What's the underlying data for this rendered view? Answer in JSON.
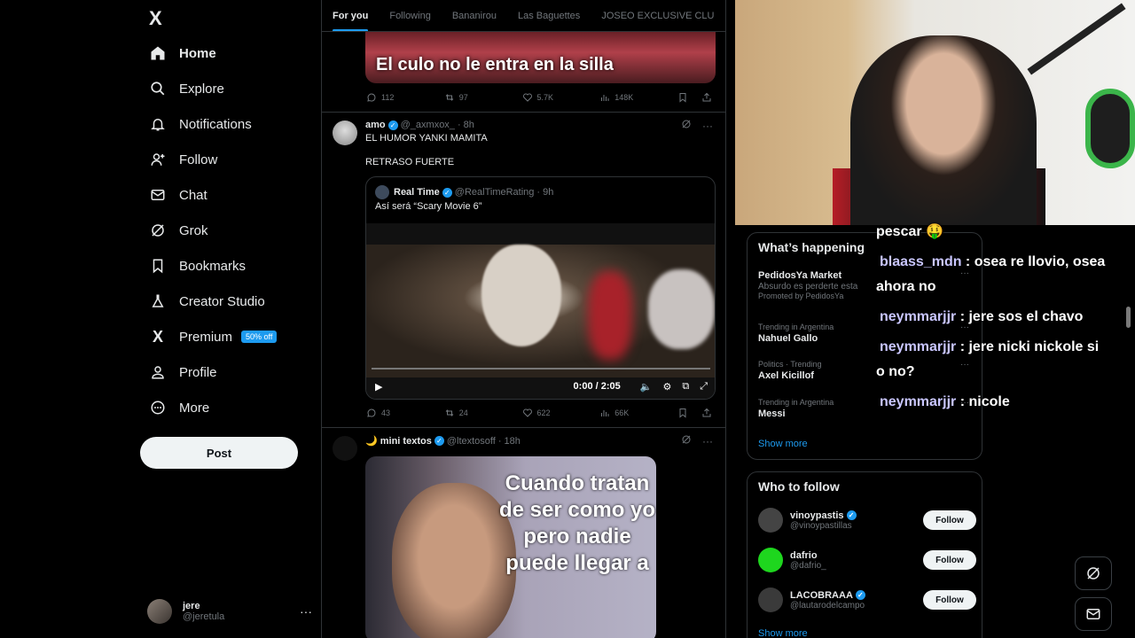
{
  "sidebar": {
    "logo": "X",
    "items": [
      {
        "label": "Home",
        "icon": "home-icon"
      },
      {
        "label": "Explore",
        "icon": "search-icon"
      },
      {
        "label": "Notifications",
        "icon": "bell-icon"
      },
      {
        "label": "Follow",
        "icon": "add-person-icon"
      },
      {
        "label": "Chat",
        "icon": "envelope-icon"
      },
      {
        "label": "Grok",
        "icon": "grok-icon"
      },
      {
        "label": "Bookmarks",
        "icon": "bookmark-icon"
      },
      {
        "label": "Creator Studio",
        "icon": "flask-icon"
      },
      {
        "label": "Premium",
        "icon": "x-logo-icon",
        "badge": "50% off"
      },
      {
        "label": "Profile",
        "icon": "person-icon"
      },
      {
        "label": "More",
        "icon": "more-circle-icon"
      }
    ],
    "post_label": "Post",
    "account": {
      "name": "jere",
      "handle": "@jeretula"
    }
  },
  "feed": {
    "tabs": [
      "For you",
      "Following",
      "Bananirou",
      "Las Baguettes",
      "JOSEO EXCLUSIVE CLU"
    ],
    "tweet1": {
      "caption": "El culo no le entra en la silla",
      "replies": "112",
      "reposts": "97",
      "likes": "5.7K",
      "views": "148K"
    },
    "tweet2": {
      "name": "amo",
      "handle": "@_axmxox_",
      "time": "8h",
      "text1": "EL HUMOR YANKI MAMITA",
      "text2": "RETRASO FUERTE",
      "quote": {
        "name": "Real Time",
        "handle": "@RealTimeRating",
        "time": "9h",
        "text": "Así será “Scary Movie 6”",
        "video_time": "0:00 / 2:05"
      },
      "replies": "43",
      "reposts": "24",
      "likes": "622",
      "views": "66K"
    },
    "tweet3": {
      "name": "🌙 mini textos",
      "handle": "@ltextosoff",
      "time": "18h",
      "meme": "Cuando tratan de ser como yo pero nadie puede llegar a"
    }
  },
  "trends": {
    "title": "What’s happening",
    "promo": {
      "title": "PedidosYa Market",
      "desc": "Absurdo es perderte esta",
      "meta": "Promoted by PedidosYa"
    },
    "items": [
      {
        "meta": "Trending in Argentina",
        "title": "Nahuel Gallo"
      },
      {
        "meta": "Politics · Trending",
        "title": "Axel Kicillof"
      },
      {
        "meta": "Trending in Argentina",
        "title": "Messi"
      }
    ],
    "show_more": "Show more"
  },
  "who_to_follow": {
    "title": "Who to follow",
    "users": [
      {
        "name": "vinoypastis",
        "handle": "@vinoypastillas",
        "verified": true
      },
      {
        "name": "dafrio",
        "handle": "@dafrio_",
        "verified": false
      },
      {
        "name": "LACOBRAAA",
        "handle": "@lautarodelcampo",
        "verified": true
      }
    ],
    "follow_label": "Follow",
    "show_more": "Show more"
  },
  "chat_overlay": [
    {
      "user": "",
      "text": "pescar 🤑"
    },
    {
      "user": "blaass_mdn",
      "text": " : osea re llovio, osea"
    },
    {
      "user": "",
      "text": "ahora no"
    },
    {
      "user": "neymmarjjr",
      "text": " : jere sos el chavo"
    },
    {
      "user": "neymmarjjr",
      "text": " : jere nicki nickole si"
    },
    {
      "user": "",
      "text": "o no?"
    },
    {
      "user": "neymmarjjr",
      "text": " : nicole"
    }
  ],
  "colors": {
    "accent": "#1d9bf0",
    "background": "#000000",
    "border": "#2f3336",
    "muted": "#71767b"
  }
}
